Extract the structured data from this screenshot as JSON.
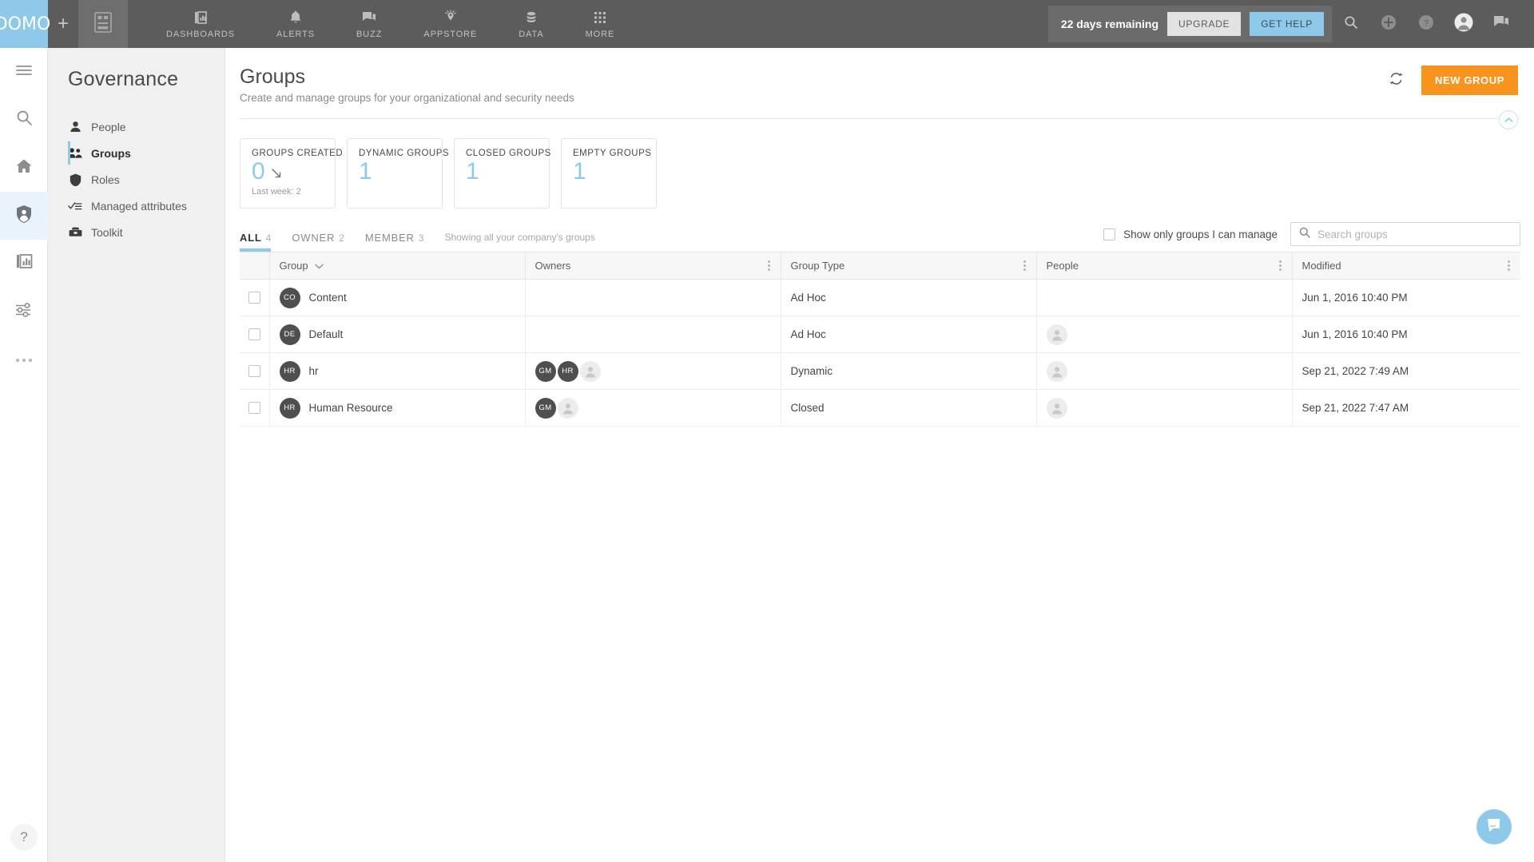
{
  "topnav": {
    "logo": "DOMO",
    "add_label": "+",
    "items": [
      {
        "label": "DASHBOARDS",
        "icon": "dashboards-icon"
      },
      {
        "label": "ALERTS",
        "icon": "bell-icon"
      },
      {
        "label": "BUZZ",
        "icon": "chat-icon"
      },
      {
        "label": "APPSTORE",
        "icon": "appstore-icon"
      },
      {
        "label": "DATA",
        "icon": "database-icon"
      },
      {
        "label": "MORE",
        "icon": "grid-icon"
      }
    ],
    "trial_text": "22 days remaining",
    "upgrade_label": "UPGRADE",
    "get_help_label": "GET HELP",
    "right_icons": [
      "search-icon",
      "plus-circle-icon",
      "question-circle-icon",
      "avatar-icon",
      "buzz-icon"
    ]
  },
  "rail": {
    "items": [
      {
        "icon": "hamburger-icon",
        "active": false
      },
      {
        "icon": "search-icon",
        "active": false
      },
      {
        "icon": "home-icon",
        "active": false
      },
      {
        "icon": "governance-shield-icon",
        "active": true
      },
      {
        "icon": "cards-icon",
        "active": false
      },
      {
        "icon": "sliders-icon",
        "active": false
      },
      {
        "icon": "more-dots-icon",
        "active": false
      }
    ],
    "help_label": "?"
  },
  "sidebar": {
    "title": "Governance",
    "items": [
      {
        "label": "People",
        "icon": "person-icon",
        "active": false
      },
      {
        "label": "Groups",
        "icon": "people-group-icon",
        "active": true
      },
      {
        "label": "Roles",
        "icon": "shield-icon",
        "active": false
      },
      {
        "label": "Managed attributes",
        "icon": "checklist-icon",
        "active": false
      },
      {
        "label": "Toolkit",
        "icon": "toolbox-icon",
        "active": false
      }
    ]
  },
  "page": {
    "title": "Groups",
    "subtitle": "Create and manage groups for your organizational and security needs",
    "refresh_icon": "refresh-icon",
    "new_group_label": "NEW GROUP",
    "collapse_icon": "chevron-up-icon"
  },
  "stats": [
    {
      "label": "GROUPS CREATED",
      "value": "0",
      "trend": "down-right-arrow",
      "footnote": "Last week: 2"
    },
    {
      "label": "DYNAMIC GROUPS",
      "value": "1",
      "trend": "",
      "footnote": ""
    },
    {
      "label": "CLOSED GROUPS",
      "value": "1",
      "trend": "",
      "footnote": ""
    },
    {
      "label": "EMPTY GROUPS",
      "value": "1",
      "trend": "",
      "footnote": ""
    }
  ],
  "tabs": [
    {
      "label": "ALL",
      "count": "4",
      "active": true
    },
    {
      "label": "OWNER",
      "count": "2",
      "active": false
    },
    {
      "label": "MEMBER",
      "count": "3",
      "active": false
    }
  ],
  "tabs_note": "Showing all your company's groups",
  "filter": {
    "checkbox_label": "Show only groups I can manage",
    "checked": false,
    "search_placeholder": "Search groups",
    "search_value": "",
    "search_icon": "search-icon"
  },
  "table": {
    "columns": [
      {
        "label": "Group",
        "sort": "chevron-down-icon",
        "menu": false
      },
      {
        "label": "Owners",
        "sort": "",
        "menu": true
      },
      {
        "label": "Group Type",
        "sort": "",
        "menu": true
      },
      {
        "label": "People",
        "sort": "",
        "menu": true
      },
      {
        "label": "Modified",
        "sort": "",
        "menu": true
      }
    ],
    "rows": [
      {
        "initials": "CO",
        "group": "Content",
        "owners": [],
        "owner_ghosts": 0,
        "type": "Ad Hoc",
        "people_ghosts": 0,
        "modified": "Jun 1, 2016 10:40 PM"
      },
      {
        "initials": "DE",
        "group": "Default",
        "owners": [],
        "owner_ghosts": 0,
        "type": "Ad Hoc",
        "people_ghosts": 1,
        "modified": "Jun 1, 2016 10:40 PM"
      },
      {
        "initials": "HR",
        "group": "hr",
        "owners": [
          "GM",
          "HR"
        ],
        "owner_ghosts": 1,
        "type": "Dynamic",
        "people_ghosts": 1,
        "modified": "Sep 21, 2022 7:49 AM"
      },
      {
        "initials": "HR",
        "group": "Human Resource",
        "owners": [
          "GM"
        ],
        "owner_ghosts": 1,
        "type": "Closed",
        "people_ghosts": 1,
        "modified": "Sep 21, 2022 7:47 AM"
      }
    ]
  },
  "chat_fab": {
    "icon": "chat-bubble-icon"
  },
  "colors": {
    "brand_blue": "#8ec9ea",
    "accent_orange": "#f7941e",
    "topnav_bg": "#5c5c5c",
    "sidebar_bg": "#f0f0f0",
    "avatar_bg": "#4f4f4f"
  }
}
